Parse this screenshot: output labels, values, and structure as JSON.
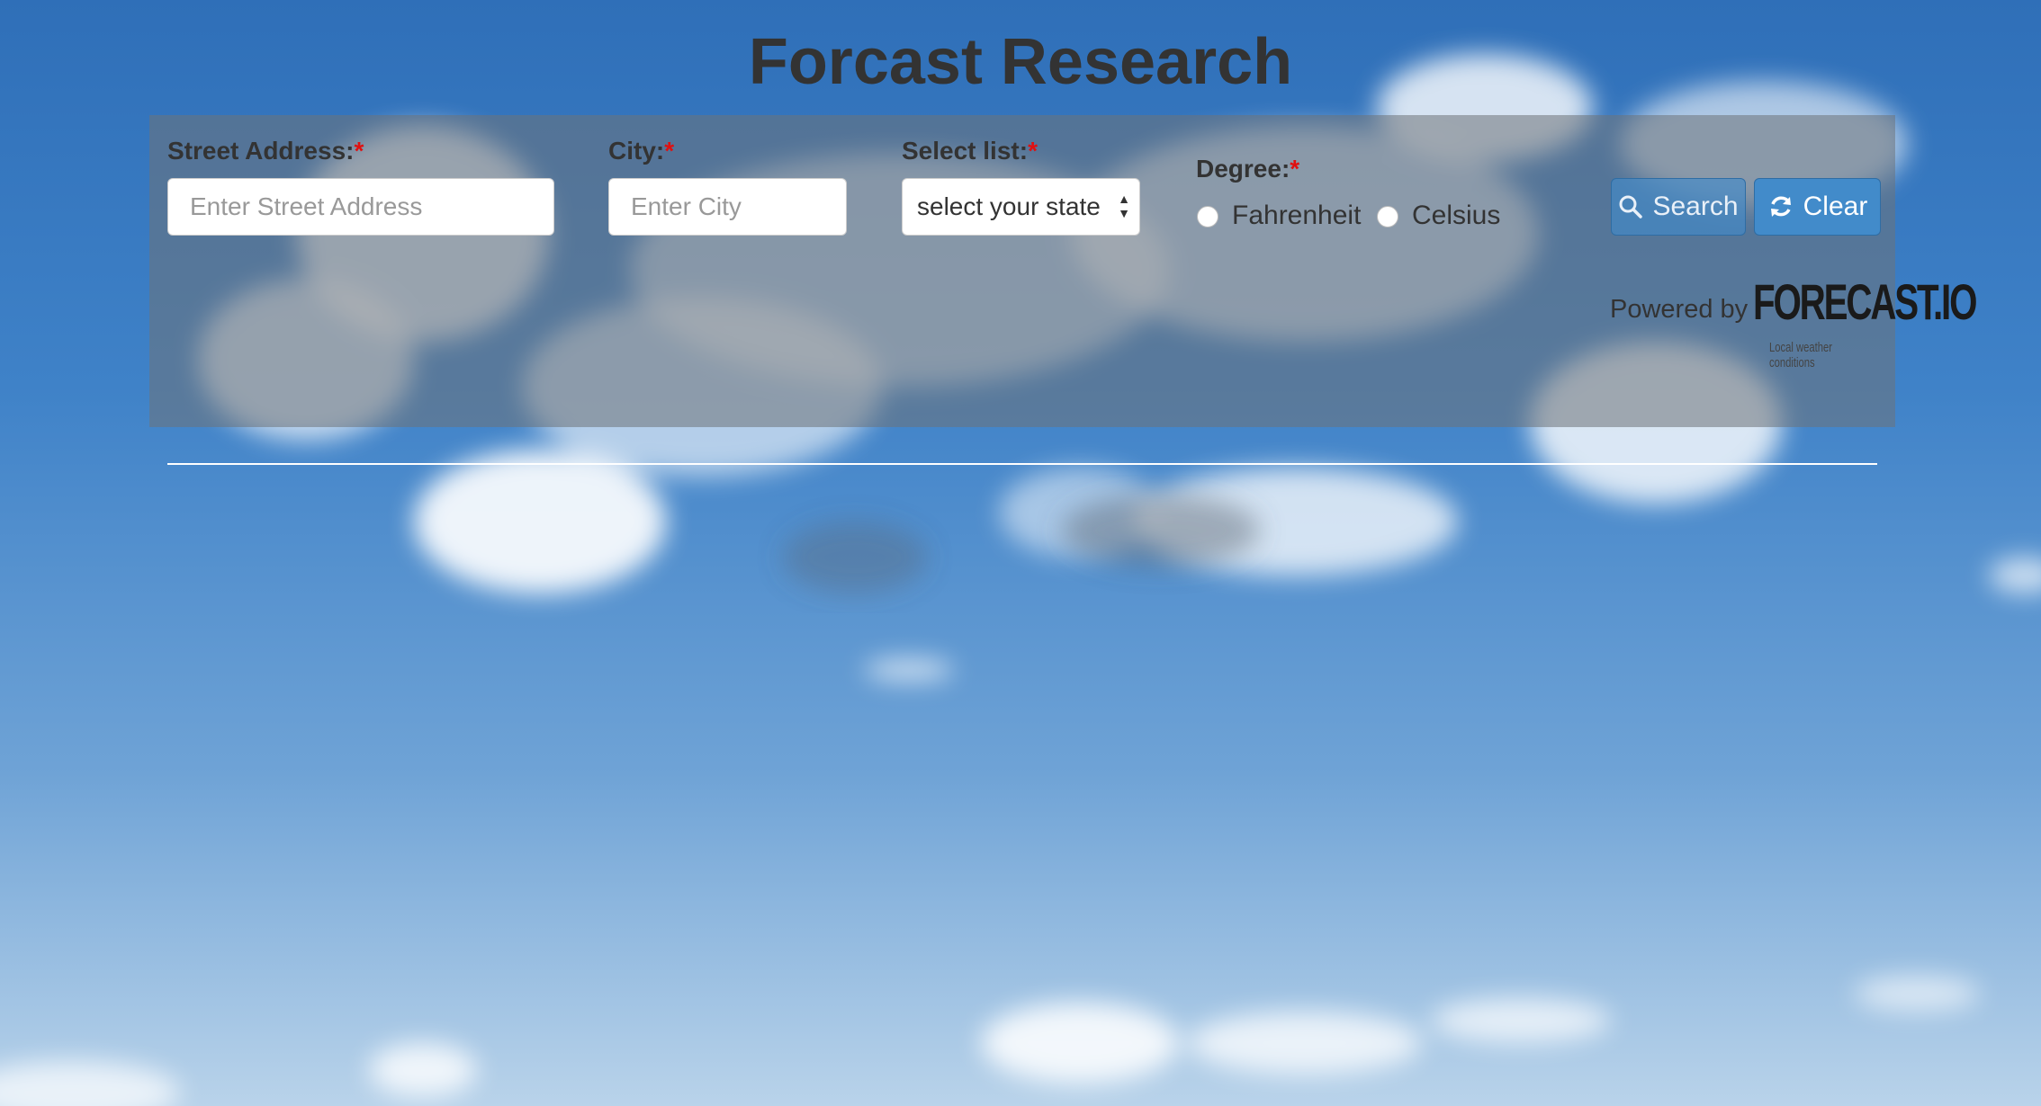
{
  "page": {
    "title": "Forcast Research"
  },
  "form": {
    "street": {
      "label": "Street Address:",
      "required_mark": "*",
      "placeholder": "Enter Street Address",
      "value": ""
    },
    "city": {
      "label": "City:",
      "required_mark": "*",
      "placeholder": "Enter City",
      "value": ""
    },
    "state": {
      "label": "Select list:",
      "required_mark": "*",
      "selected": "select your state"
    },
    "degree": {
      "label": "Degree:",
      "required_mark": "*",
      "options": [
        {
          "label": "Fahrenheit",
          "checked": false
        },
        {
          "label": "Celsius",
          "checked": false
        }
      ]
    },
    "search_label": "Search",
    "clear_label": "Clear"
  },
  "footer": {
    "powered_by": "Powered by",
    "logo": "FORECAST.IO",
    "logo_tagline": "Local weather conditions"
  },
  "icons": {
    "search": "search-icon",
    "clear": "refresh-icon",
    "select": "updown-arrows-icon"
  },
  "colors": {
    "accent": "#428bca",
    "required": "#e01010",
    "panel": "#6e7378",
    "title": "#333333"
  }
}
